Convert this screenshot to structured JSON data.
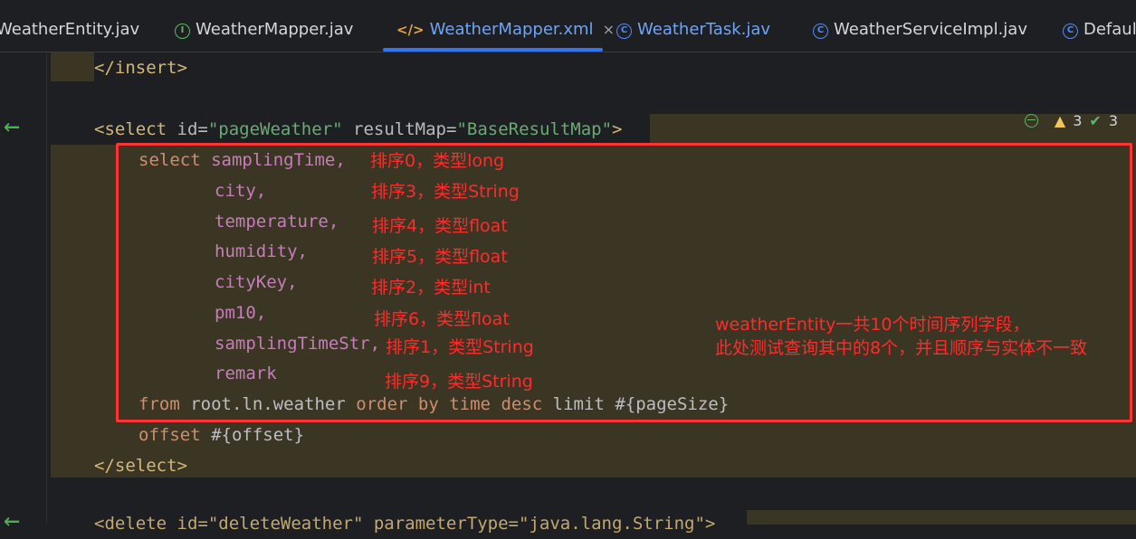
{
  "tabs": [
    {
      "label": "WeatherEntity.jav",
      "icon": "",
      "active": false
    },
    {
      "label": "WeatherMapper.jav",
      "icon": "I",
      "active": false
    },
    {
      "label": "WeatherMapper.xml",
      "icon": "</>",
      "active": true
    },
    {
      "label": "WeatherTask.jav",
      "icon": "C",
      "active": false
    },
    {
      "label": "WeatherServiceImpl.jav",
      "icon": "C",
      "active": false
    },
    {
      "label": "Defaul",
      "icon": "C",
      "active": false
    }
  ],
  "tab_close": "×",
  "inspections": {
    "warnings": "3",
    "checks": "3"
  },
  "code": {
    "l1": "</insert>",
    "l3_open": "<select ",
    "l3_attr1": "id",
    "l3_val1": "\"pageWeather\"",
    "l3_attr2": "resultMap",
    "l3_val2": "\"BaseResultMap\"",
    "l3_close": ">",
    "select_kw": "select",
    "cols": [
      "samplingTime,",
      "city,",
      "temperature,",
      "humidity,",
      "cityKey,",
      "pm10,",
      "samplingTimeStr,",
      "remark"
    ],
    "from_kw": "from",
    "table": "root.ln.weather",
    "order_kw": "order by",
    "time_kw": "time",
    "desc_kw": "desc",
    "limit_kw": "limit",
    "page_size": "#{pageSize}",
    "offset_kw": "offset",
    "offset_val": "#{offset}",
    "end_select": "</select>",
    "delete_line": "<delete id=\"deleteWeather\" parameterType=\"java.lang.String\">"
  },
  "notes": [
    "排序0，类型long",
    "排序3，类型String",
    "排序4，类型float",
    "排序5，类型float",
    "排序2，类型int",
    "排序6，类型float",
    "排序1，类型String",
    "排序9，类型String"
  ],
  "summary": {
    "line1": "weatherEntity一共10个时间序列字段，",
    "line2": "此处测试查询其中的8个，并且顺序与实体不一致"
  },
  "colors": {
    "annotation": "#ff2b2b",
    "active_tab": "#6fa4f6"
  }
}
